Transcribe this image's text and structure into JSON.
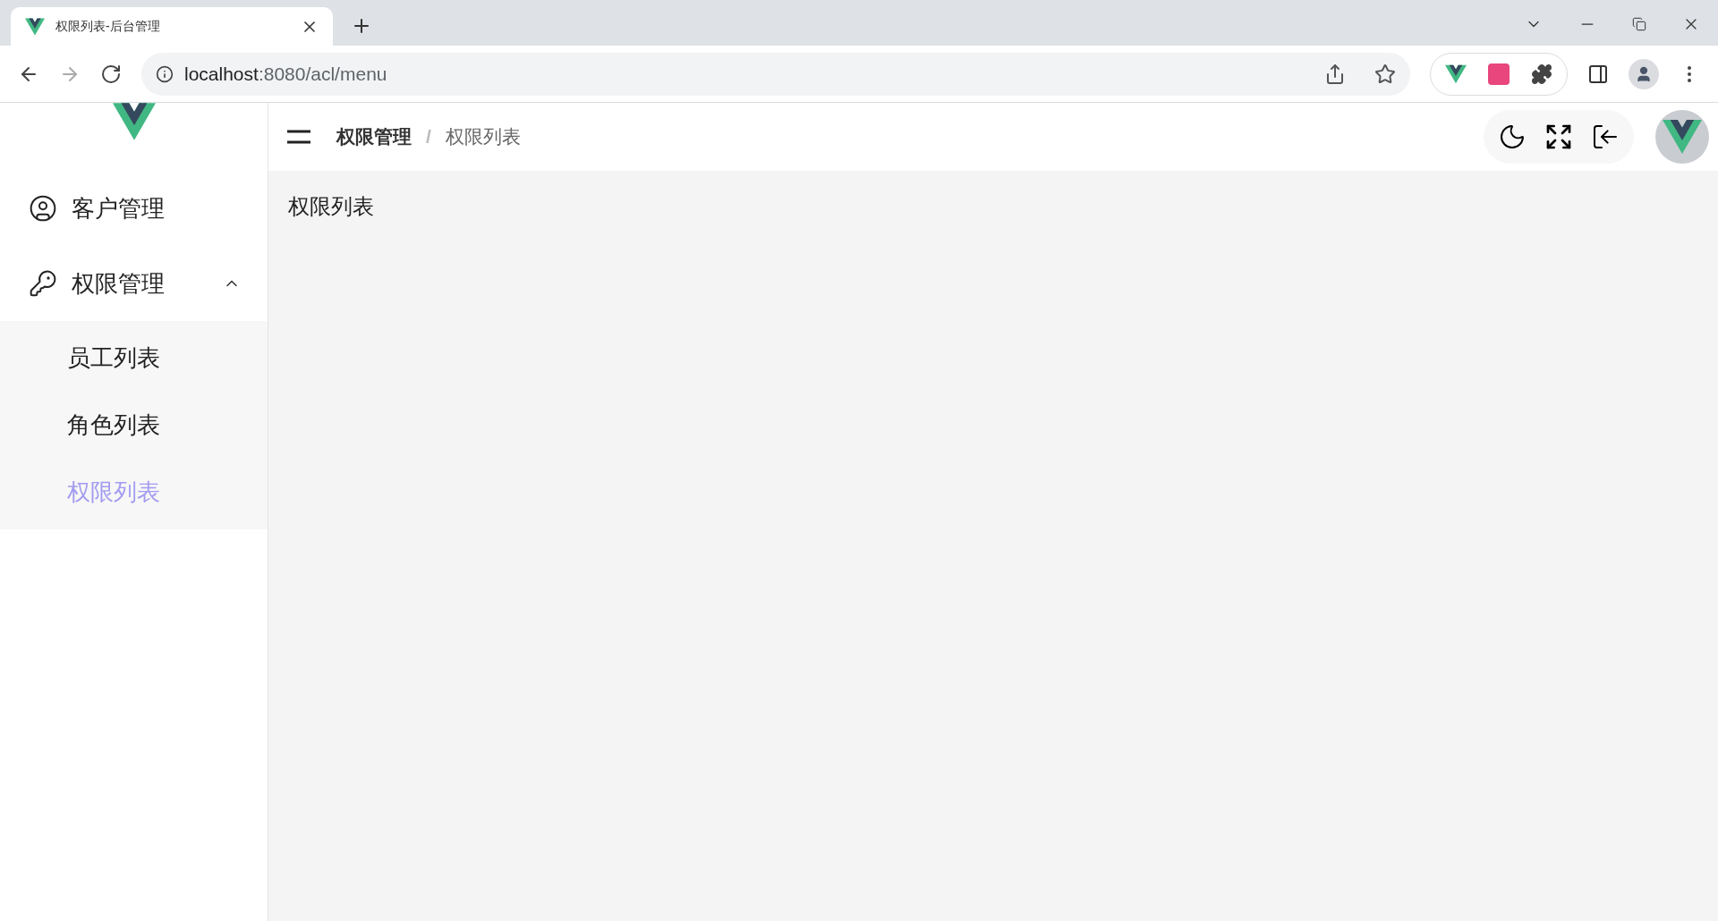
{
  "browser": {
    "tab_title": "权限列表-后台管理",
    "url_host": "localhost",
    "url_path": ":8080/acl/menu"
  },
  "sidebar": {
    "items": [
      {
        "label": "客户管理",
        "kind": "user"
      },
      {
        "label": "权限管理",
        "kind": "key",
        "expanded": true,
        "children": [
          {
            "label": "员工列表",
            "selected": false
          },
          {
            "label": "角色列表",
            "selected": false
          },
          {
            "label": "权限列表",
            "selected": true
          }
        ]
      }
    ]
  },
  "breadcrumb": [
    {
      "label": "权限管理"
    },
    {
      "label": "权限列表",
      "separator": "/"
    }
  ],
  "content": {
    "title": "权限列表"
  }
}
